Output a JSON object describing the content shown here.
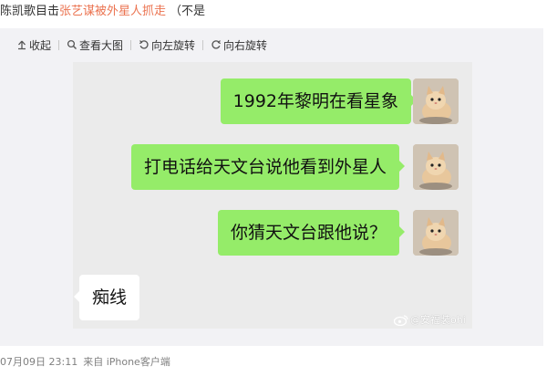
{
  "post": {
    "author": "陈凯歌",
    "text_before": "目击",
    "highlight": "张艺谋被外星人抓走",
    "text_after": "（不是"
  },
  "toolbar": {
    "collapse": "收起",
    "view_large": "查看大图",
    "rotate_left": "向左旋转",
    "rotate_right": "向右旋转"
  },
  "chat": {
    "messages": [
      {
        "side": "out",
        "text": "1992年黎明在看星象"
      },
      {
        "side": "out",
        "text": "打电话给天文台说他看到外星人"
      },
      {
        "side": "out",
        "text": "你猜天文台跟他说？"
      },
      {
        "side": "in",
        "text": "痴线"
      }
    ],
    "colors": {
      "outgoing_bubble": "#95ec69",
      "incoming_bubble": "#ffffff",
      "chat_bg": "#ebebeb"
    }
  },
  "watermark": "@安福装ohi",
  "meta": {
    "datetime": "07月09日 23:11",
    "source": "来自 iPhone客户端"
  },
  "icons": [
    "collapse-arrow-icon",
    "magnifier-icon",
    "rotate-left-icon",
    "rotate-right-icon",
    "weibo-logo-icon"
  ],
  "accent_color": "#eb7350"
}
